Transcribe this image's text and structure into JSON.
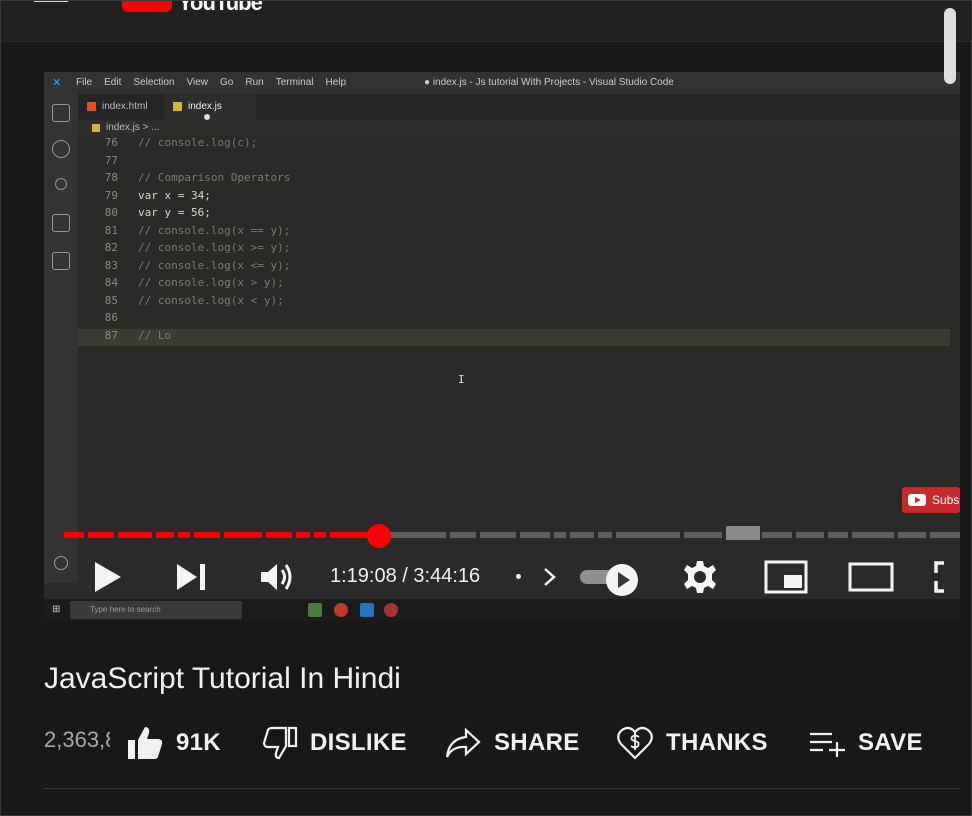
{
  "masthead": {
    "logo_text": "YouTube"
  },
  "vscode": {
    "menu": [
      "File",
      "Edit",
      "Selection",
      "View",
      "Go",
      "Run",
      "Terminal",
      "Help"
    ],
    "window_title": "● index.js - Js tutorial With Projects - Visual Studio Code",
    "tabs": [
      {
        "label": "index.html",
        "color": "#e44d26"
      },
      {
        "label": "index.js",
        "color": "#d8b437"
      }
    ],
    "breadcrumb": "index.js > ...",
    "code": [
      {
        "n": "76",
        "text": "// console.log(c);"
      },
      {
        "n": "77",
        "text": ""
      },
      {
        "n": "78",
        "text": "// Comparison Operators"
      },
      {
        "n": "79",
        "text": "var x = 34;"
      },
      {
        "n": "80",
        "text": "var y = 56;"
      },
      {
        "n": "81",
        "text": "// console.log(x == y);"
      },
      {
        "n": "82",
        "text": "// console.log(x >= y);"
      },
      {
        "n": "83",
        "text": "// console.log(x <= y);"
      },
      {
        "n": "84",
        "text": "// console.log(x > y);"
      },
      {
        "n": "85",
        "text": "// console.log(x < y);"
      },
      {
        "n": "86",
        "text": ""
      },
      {
        "n": "87",
        "text": "// Lo"
      }
    ],
    "taskbar_search": "Type here to search"
  },
  "player": {
    "subscribe_badge": "Subs",
    "current_time": "1:19:08",
    "duration": "3:44:16",
    "time_display": "1:19:08 / 3:44:16",
    "progress_fraction": 0.352,
    "played_color": "#ff0000",
    "autoplay": true
  },
  "video": {
    "title": "JavaScript Tutorial In Hindi",
    "views": "2,363,8",
    "actions": {
      "like": "91K",
      "dislike": "DISLIKE",
      "share": "SHARE",
      "thanks": "THANKS",
      "save": "SAVE"
    }
  }
}
